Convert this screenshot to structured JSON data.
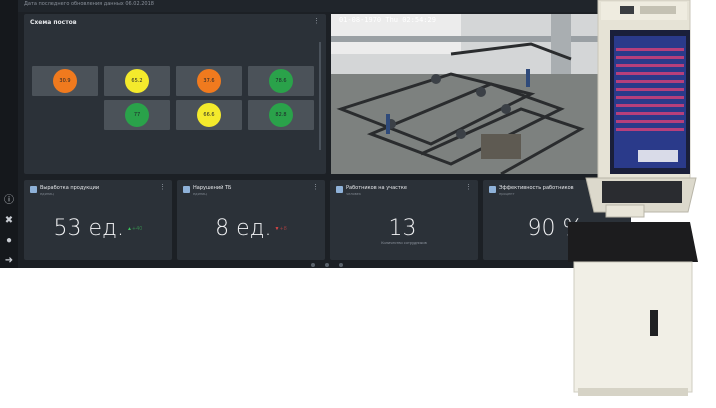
{
  "header": {
    "update_text": "Дата последнего обновления данных 06.02.2018"
  },
  "sidebar": {
    "icons": [
      "info-icon",
      "tools-icon",
      "user-icon",
      "logout-icon"
    ]
  },
  "scheme": {
    "title": "Схема постов",
    "posts": [
      {
        "value": "30.9",
        "color": "#f07a1e"
      },
      {
        "value": "65.2",
        "color": "#f4ea2c"
      },
      {
        "value": "37.6",
        "color": "#f07a1e"
      },
      {
        "value": "78.6",
        "color": "#2aa24a"
      },
      {
        "value": "77",
        "color": "#2aa24a"
      },
      {
        "value": "66.6",
        "color": "#f4ea2c"
      },
      {
        "value": "82.8",
        "color": "#2aa24a"
      }
    ]
  },
  "camera": {
    "timestamp": "01-08-1970 Thu 02:54:29"
  },
  "cards": [
    {
      "title": "Выработка продукции",
      "subtitle": "единиц",
      "value": "53 ед.",
      "delta": "▲+40",
      "delta_color": "#3bbf5a",
      "desc": ""
    },
    {
      "title": "Нарушений ТБ",
      "subtitle": "единиц",
      "value": "8 ед.",
      "delta": "▼+8",
      "delta_color": "#e04646",
      "desc": ""
    },
    {
      "title": "Работников на участке",
      "subtitle": "человек",
      "value": "13",
      "delta": "",
      "delta_color": "",
      "desc": "Количество сотрудников"
    },
    {
      "title": "Эффективность работников",
      "subtitle": "процент",
      "value": "90 %",
      "delta": "",
      "delta_color": "",
      "desc": ""
    }
  ],
  "colors": {
    "background": "#1c2025",
    "panel": "#2b3138",
    "accent": "#8fb2d9"
  }
}
